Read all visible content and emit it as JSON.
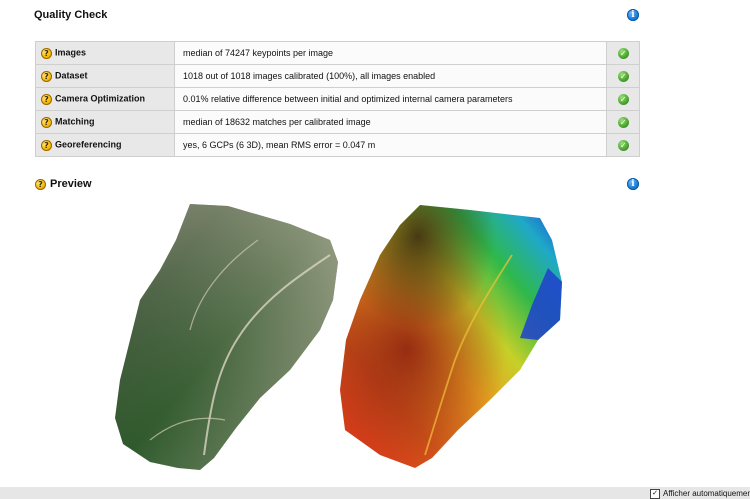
{
  "quality_check": {
    "title": "Quality Check",
    "info_icon": "info-icon",
    "rows": [
      {
        "label": "Images",
        "value": "median of 74247 keypoints per image",
        "status": "ok"
      },
      {
        "label": "Dataset",
        "value": "1018 out of 1018 images calibrated (100%), all images enabled",
        "status": "ok"
      },
      {
        "label": "Camera Optimization",
        "value": "0.01% relative difference between initial and optimized internal camera parameters",
        "status": "ok"
      },
      {
        "label": "Matching",
        "value": "median of 18632 matches per calibrated image",
        "status": "ok"
      },
      {
        "label": "Georeferencing",
        "value": "yes, 6 GCPs (6 3D), mean RMS error = 0.047 m",
        "status": "ok"
      }
    ]
  },
  "preview": {
    "title": "Preview",
    "images": [
      "orthomosaic-preview",
      "dsm-elevation-preview"
    ]
  },
  "footer": {
    "checkbox_label": "Afficher automatiquement",
    "checked": true
  },
  "colors": {
    "info": "#1e7fd6",
    "help": "#f4b400",
    "ok": "#4aa32f"
  }
}
